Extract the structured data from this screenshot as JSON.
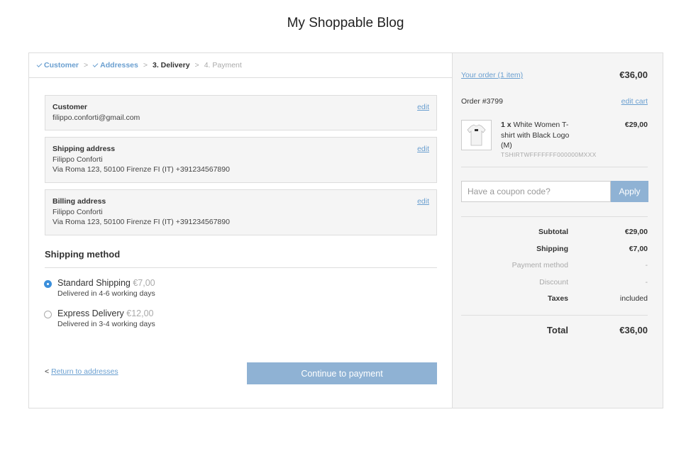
{
  "site": {
    "title": "My Shoppable Blog"
  },
  "breadcrumb": {
    "steps": [
      {
        "label": "Customer",
        "state": "done"
      },
      {
        "label": "Addresses",
        "state": "done"
      },
      {
        "label": "3. Delivery",
        "state": "current"
      },
      {
        "label": "4. Payment",
        "state": "future"
      }
    ],
    "separator": ">"
  },
  "customer_box": {
    "title": "Customer",
    "email": "filippo.conforti@gmail.com",
    "edit_label": "edit"
  },
  "shipping_box": {
    "title": "Shipping address",
    "name": "Filippo Conforti",
    "address": "Via Roma 123, 50100 Firenze FI (IT) +391234567890",
    "edit_label": "edit"
  },
  "billing_box": {
    "title": "Billing address",
    "name": "Filippo Conforti",
    "address": "Via Roma 123, 50100 Firenze FI (IT) +391234567890",
    "edit_label": "edit"
  },
  "shipping_method": {
    "title": "Shipping method",
    "options": [
      {
        "name": "Standard Shipping",
        "price": "€7,00",
        "desc": "Delivered in 4-6 working days",
        "selected": true
      },
      {
        "name": "Express Delivery",
        "price": "€12,00",
        "desc": "Delivered in 3-4 working days",
        "selected": false
      }
    ]
  },
  "footer": {
    "back_prefix": "<",
    "back_label": "Return to addresses",
    "continue_label": "Continue to payment"
  },
  "sidebar": {
    "your_order_label": "Your order (1 item)",
    "order_total": "€36,00",
    "order_number": "Order #3799",
    "edit_cart_label": "edit cart",
    "item": {
      "qty": "1 x",
      "name": "White Women T-shirt with Black Logo (M)",
      "sku": "TSHIRTWFFFFFFF000000MXXX",
      "price": "€29,00"
    },
    "coupon": {
      "placeholder": "Have a coupon code?",
      "apply_label": "Apply"
    },
    "summary": {
      "subtotal_label": "Subtotal",
      "subtotal_value": "€29,00",
      "shipping_label": "Shipping",
      "shipping_value": "€7,00",
      "payment_label": "Payment method",
      "payment_value": "-",
      "discount_label": "Discount",
      "discount_value": "-",
      "taxes_label": "Taxes",
      "taxes_value": "included",
      "total_label": "Total",
      "total_value": "€36,00"
    }
  },
  "colors": {
    "link": "#6a9fd0",
    "button": "#8fb2d4",
    "radio_selected": "#3b8fdb"
  }
}
